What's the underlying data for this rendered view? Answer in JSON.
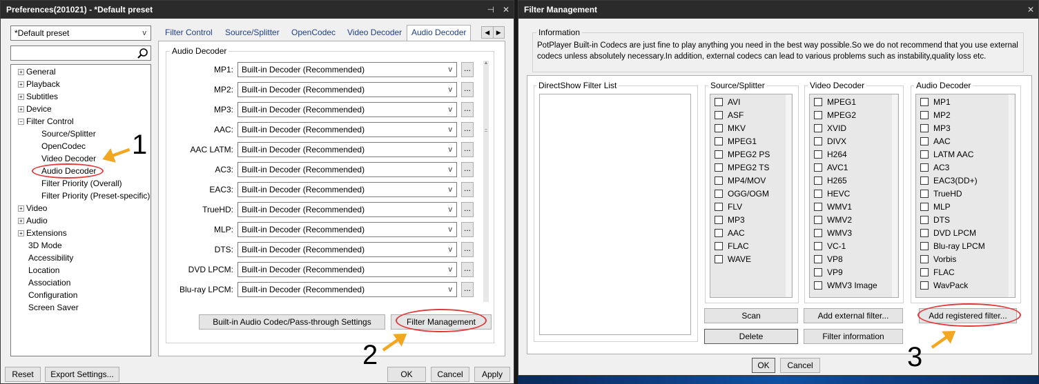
{
  "left_window": {
    "title": "Preferences(201021) - *Default preset",
    "title_icons": [
      "pin-icon",
      "close-icon"
    ],
    "preset": "*Default preset",
    "search_placeholder": "",
    "tree": [
      {
        "label": "General",
        "expandable": true,
        "indent": 0
      },
      {
        "label": "Playback",
        "expandable": true,
        "indent": 0
      },
      {
        "label": "Subtitles",
        "expandable": true,
        "indent": 0
      },
      {
        "label": "Device",
        "expandable": true,
        "indent": 0
      },
      {
        "label": "Filter Control",
        "expandable": true,
        "expanded": true,
        "indent": 0
      },
      {
        "label": "Source/Splitter",
        "expandable": false,
        "indent": 1
      },
      {
        "label": "OpenCodec",
        "expandable": false,
        "indent": 1
      },
      {
        "label": "Video Decoder",
        "expandable": false,
        "indent": 1
      },
      {
        "label": "Audio Decoder",
        "expandable": false,
        "indent": 1,
        "selected": true
      },
      {
        "label": "Filter Priority (Overall)",
        "expandable": false,
        "indent": 1
      },
      {
        "label": "Filter Priority (Preset-specific)",
        "expandable": false,
        "indent": 1
      },
      {
        "label": "Video",
        "expandable": true,
        "indent": 0
      },
      {
        "label": "Audio",
        "expandable": true,
        "indent": 0
      },
      {
        "label": "Extensions",
        "expandable": true,
        "indent": 0
      },
      {
        "label": "3D Mode",
        "expandable": false,
        "indent": 0
      },
      {
        "label": "Accessibility",
        "expandable": false,
        "indent": 0
      },
      {
        "label": "Location",
        "expandable": false,
        "indent": 0
      },
      {
        "label": "Association",
        "expandable": false,
        "indent": 0
      },
      {
        "label": "Configuration",
        "expandable": false,
        "indent": 0
      },
      {
        "label": "Screen Saver",
        "expandable": false,
        "indent": 0
      }
    ],
    "tabs": [
      "Filter Control",
      "Source/Splitter",
      "OpenCodec",
      "Video Decoder",
      "Audio Decoder"
    ],
    "active_tab": "Audio Decoder",
    "group_label": "Audio Decoder",
    "decoder_rows": [
      {
        "label": "MP1:",
        "value": "Built-in Decoder (Recommended)"
      },
      {
        "label": "MP2:",
        "value": "Built-in Decoder (Recommended)"
      },
      {
        "label": "MP3:",
        "value": "Built-in Decoder (Recommended)"
      },
      {
        "label": "AAC:",
        "value": "Built-in Decoder (Recommended)"
      },
      {
        "label": "AAC LATM:",
        "value": "Built-in Decoder (Recommended)"
      },
      {
        "label": "AC3:",
        "value": "Built-in Decoder (Recommended)"
      },
      {
        "label": "EAC3:",
        "value": "Built-in Decoder (Recommended)"
      },
      {
        "label": "TrueHD:",
        "value": "Built-in Decoder (Recommended)"
      },
      {
        "label": "MLP:",
        "value": "Built-in Decoder (Recommended)"
      },
      {
        "label": "DTS:",
        "value": "Built-in Decoder (Recommended)"
      },
      {
        "label": "DVD LPCM:",
        "value": "Built-in Decoder (Recommended)"
      },
      {
        "label": "Blu-ray LPCM:",
        "value": "Built-in Decoder (Recommended)"
      }
    ],
    "dots_label": "...",
    "passthrough_button": "Built-in Audio Codec/Pass-through Settings",
    "filter_mgmt_button": "Filter Management",
    "reset_button": "Reset",
    "export_button": "Export Settings...",
    "ok_button": "OK",
    "cancel_button": "Cancel",
    "apply_button": "Apply"
  },
  "right_window": {
    "title": "Filter Management",
    "info_label": "Information",
    "info_text": "PotPlayer Built-in Codecs are just fine to play anything you need in the best way possible.So we do not recommend that you use external codecs unless absolutely necessary.In addition, external codecs can lead to various problems such as instability,quality loss etc.",
    "directshow_label": "DirectShow Filter List",
    "source_label": "Source/Splitter",
    "source_items": [
      "AVI",
      "ASF",
      "MKV",
      "MPEG1",
      "MPEG2 PS",
      "MPEG2 TS",
      "MP4/MOV",
      "OGG/OGM",
      "FLV",
      "MP3",
      "AAC",
      "FLAC",
      "WAVE"
    ],
    "video_label": "Video Decoder",
    "video_items": [
      "MPEG1",
      "MPEG2",
      "XVID",
      "DIVX",
      "H264",
      "AVC1",
      "H265",
      "HEVC",
      "WMV1",
      "WMV2",
      "WMV3",
      "VC-1",
      "VP8",
      "VP9",
      "WMV3 Image"
    ],
    "audio_label": "Audio Decoder",
    "audio_items": [
      "MP1",
      "MP2",
      "MP3",
      "AAC",
      "LATM AAC",
      "AC3",
      "EAC3(DD+)",
      "TrueHD",
      "MLP",
      "DTS",
      "DVD LPCM",
      "Blu-ray LPCM",
      "Vorbis",
      "FLAC",
      "WavPack"
    ],
    "scan_button": "Scan",
    "delete_button": "Delete",
    "add_external_button": "Add external filter...",
    "filter_info_button": "Filter information",
    "add_registered_button": "Add registered filter...",
    "ok_button": "OK",
    "cancel_button": "Cancel"
  },
  "annotations": {
    "step1": "1",
    "step2": "2",
    "step3": "3",
    "highlight_color": "#e03a3a",
    "arrow_color": "#f3a61f"
  }
}
